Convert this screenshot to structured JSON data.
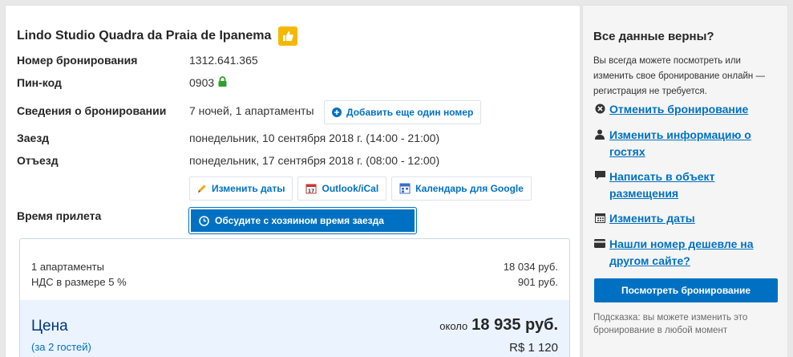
{
  "booking": {
    "hotel_name": "Lindo Studio Quadra da Praia de Ipanema",
    "confirmation_label": "Номер бронирования",
    "confirmation_value": "1312.641.365",
    "pin_label": "Пин-код",
    "pin_value": "0903",
    "details_label": "Сведения о бронировании",
    "details_value": "7 ночей, 1 апартаменты",
    "add_room_label": "Добавить еще один номер",
    "checkin_label": "Заезд",
    "checkin_value": "понедельник, 10 сентября 2018 г. (14:00 - 21:00)",
    "checkout_label": "Отъезд",
    "checkout_value": "понедельник, 17 сентября 2018 г. (08:00 - 12:00)",
    "actions": {
      "change_dates": "Изменить даты",
      "outlook": "Outlook/iCal",
      "google": "Календарь для Google"
    },
    "arrival_label": "Время прилета",
    "arrival_button": "Обсудите с хозяином время заезда"
  },
  "price": {
    "lines": [
      {
        "label": "1 апартаменты",
        "value": "18 034 руб."
      },
      {
        "label": "НДС в размере 5 %",
        "value": "901 руб."
      }
    ],
    "total_label": "Цена",
    "guests": "(за 2 гостей)",
    "approx_word": "около",
    "total_value": "18 935 руб.",
    "local_value": "R$ 1 120"
  },
  "sidebar": {
    "title": "Все данные верны?",
    "description": "Вы всегда можете посмотреть или изменить свое бронирование онлайн — регистрация не требуется.",
    "links": [
      {
        "label": "Отменить бронирование",
        "icon": "cancel-icon"
      },
      {
        "label": "Изменить информацию о гостях",
        "icon": "person-icon"
      },
      {
        "label": "Написать в объект размещения",
        "icon": "message-icon"
      },
      {
        "label": "Изменить даты",
        "icon": "calendar-icon"
      },
      {
        "label": "Нашли номер дешевле на другом сайте?",
        "icon": "card-icon"
      }
    ],
    "view_button": "Посмотреть бронирование",
    "hint": "Подсказка: вы можете изменить это бронирование в любой момент"
  },
  "colors": {
    "brand_blue": "#0071c2",
    "dark_blue": "#003580",
    "thumb_yellow": "#f5b800",
    "lock_green": "#2f9e2f"
  }
}
